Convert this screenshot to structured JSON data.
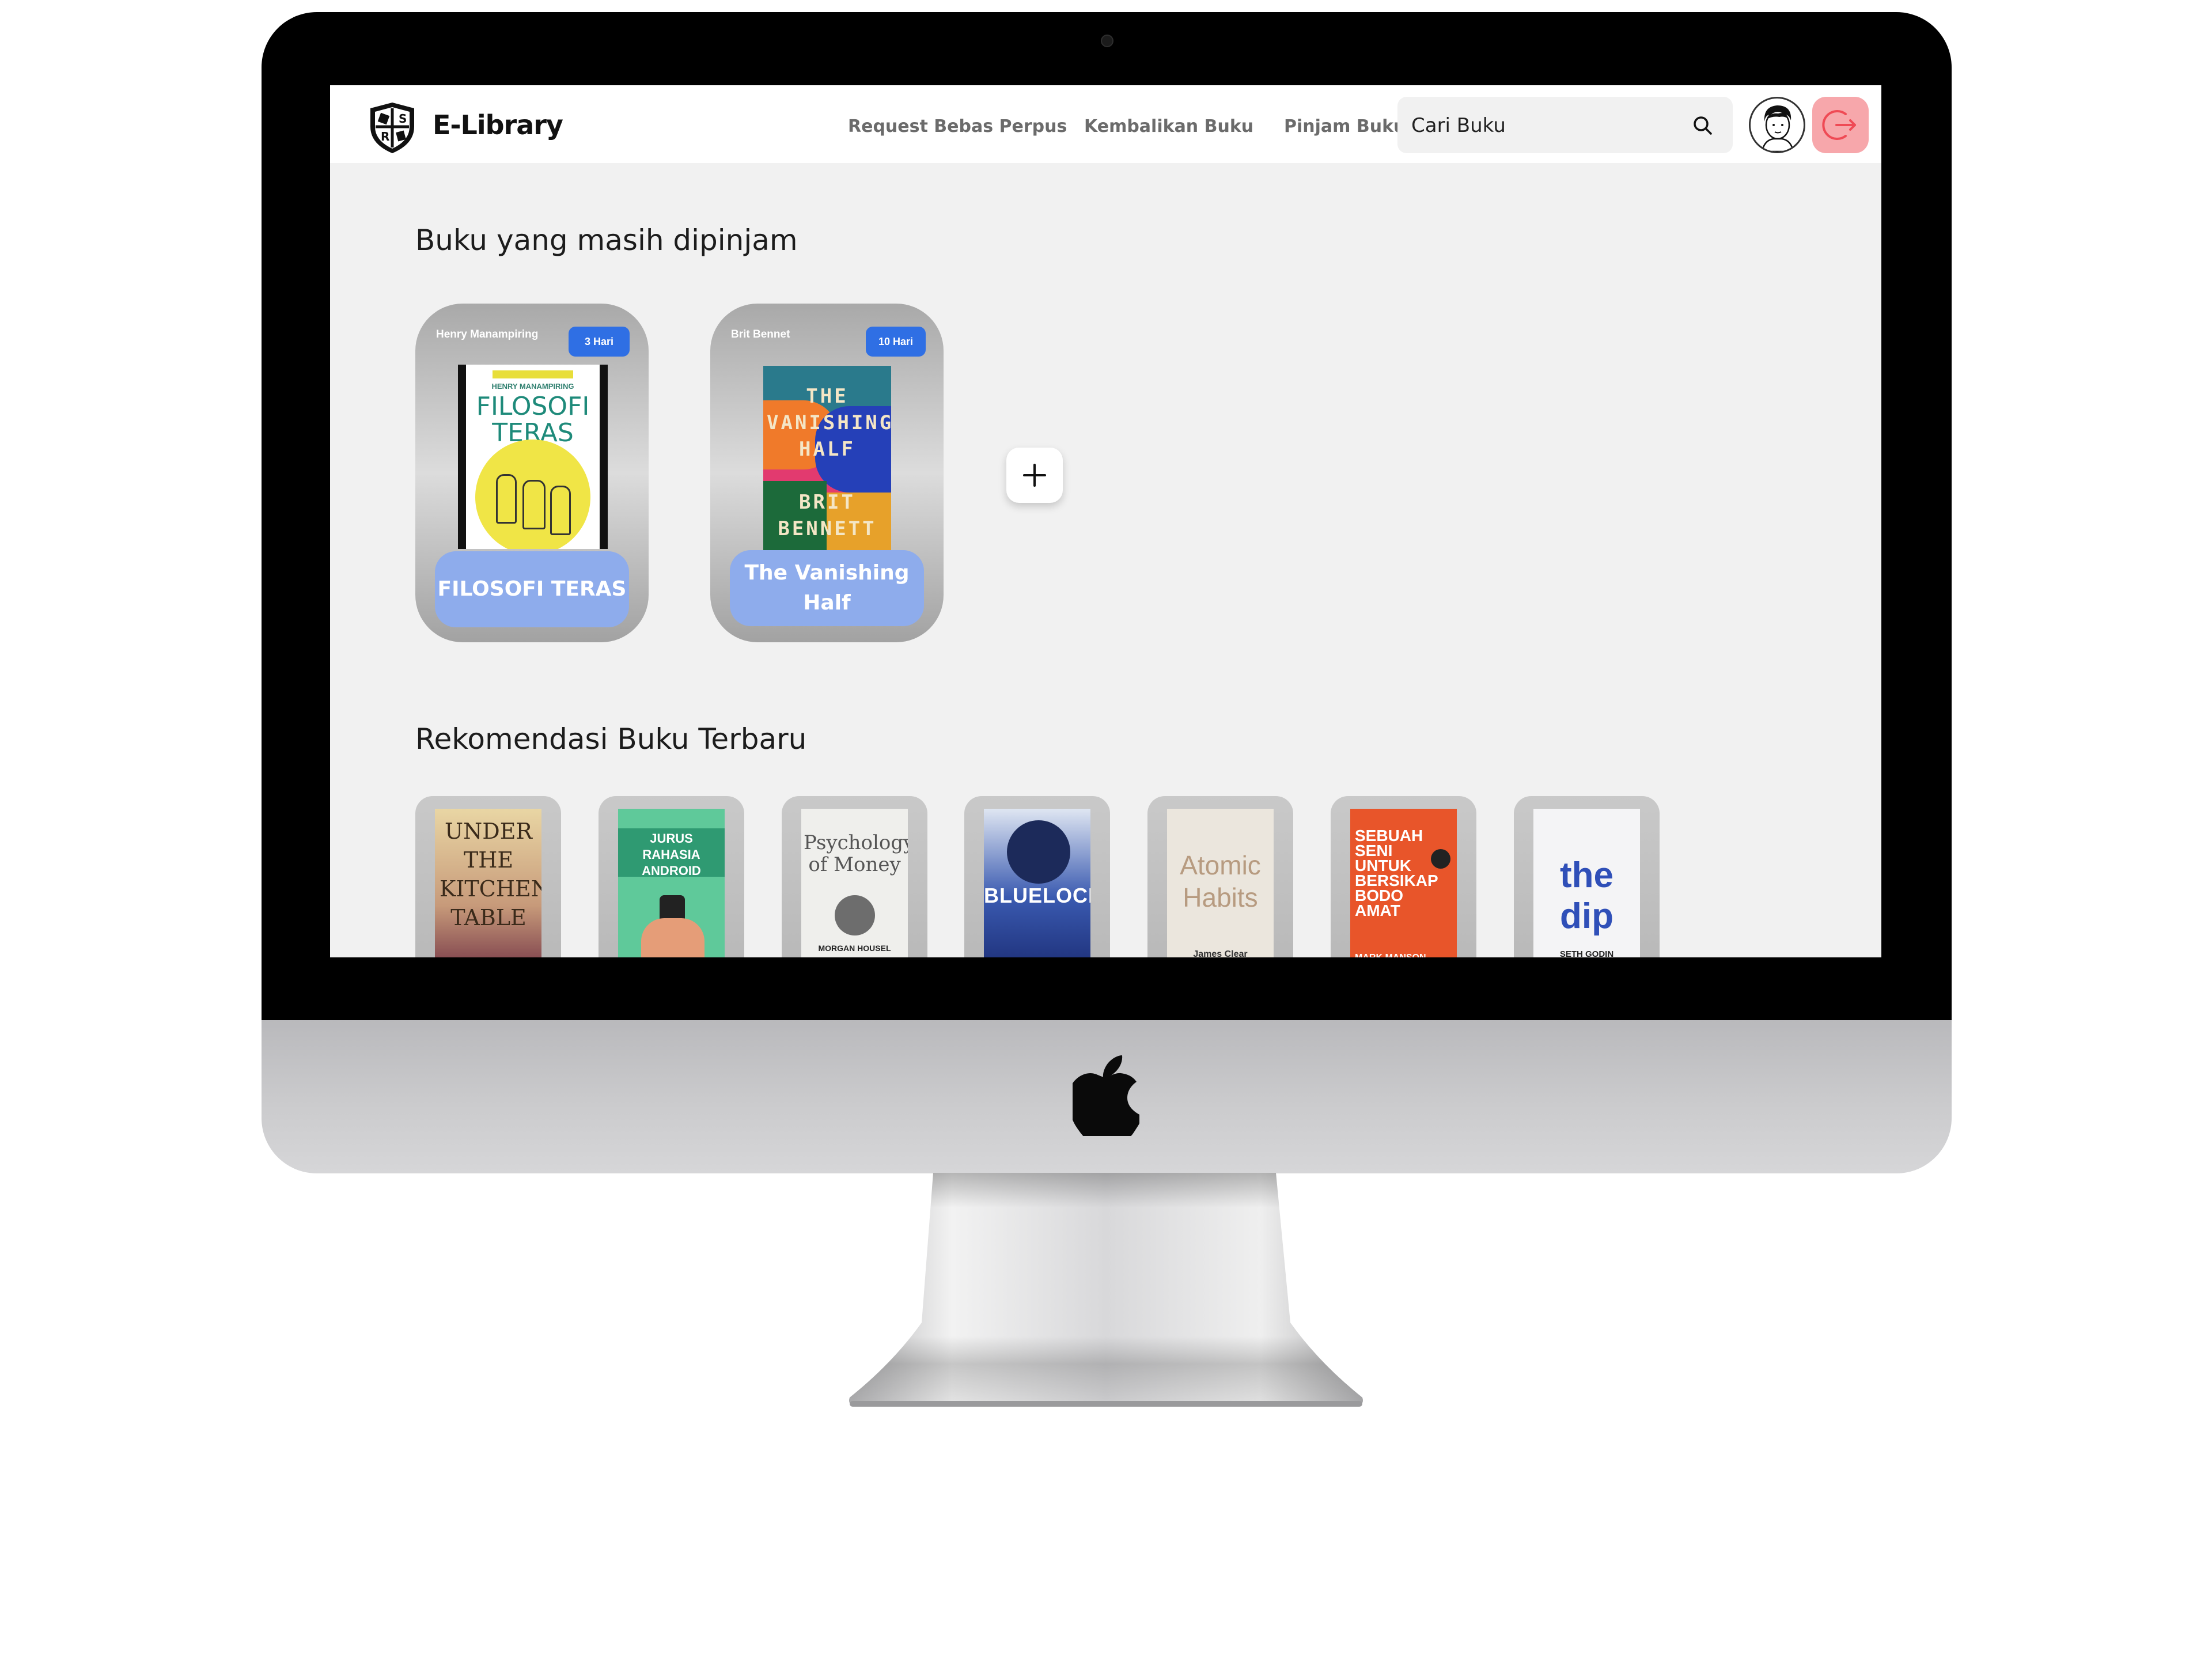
{
  "navbar": {
    "brand": "E-Library",
    "links": [
      "Request Bebas Perpus",
      "Kembalikan Buku",
      "Pinjam Buku"
    ],
    "search_placeholder": "Cari Buku"
  },
  "borrowed": {
    "title": "Buku yang masih dipinjam",
    "books": [
      {
        "author": "Henry Manampiring",
        "days": "3 Hari",
        "title": "FILOSOFI TERAS",
        "cover_top": "HENRY MANAMPIRING",
        "cover_title": "FILOSOFI TERAS",
        "cover_color": "#f3e85a"
      },
      {
        "author": "Brit Bennet",
        "days": "10 Hari",
        "title": "The Vanishing Half",
        "cover_title": "THE VANISHING HALF",
        "cover_author": "BRIT BENNETT",
        "cover_color": "#e23a6f"
      }
    ]
  },
  "recommendations": {
    "title": "Rekomendasi Buku Terbaru",
    "books": [
      {
        "cover_text": "UNDER THE KITCHEN TABLE"
      },
      {
        "cover_text": "JURUS RAHASIA ANDROID"
      },
      {
        "cover_text": "Psychology of Money",
        "cover_author": "MORGAN HOUSEL"
      },
      {
        "cover_text": "BLUELOCK"
      },
      {
        "cover_text": "Atomic Habits",
        "cover_author": "James Clear"
      },
      {
        "cover_text": "SEBUAH SENI UNTUK BERSIKAP BODO AMAT",
        "cover_author": "MARK MANSON"
      },
      {
        "cover_text": "the dip",
        "cover_author": "SETH GODIN"
      }
    ]
  },
  "colors": {
    "badge": "#2f6fe4",
    "title_button": "#8eacec",
    "logout": "#f7a7ab",
    "screen_bg": "#f1f1f1"
  },
  "icons": [
    "logo-shield-icon",
    "search-icon",
    "avatar-icon",
    "logout-icon",
    "plus-icon",
    "apple-logo-icon"
  ]
}
